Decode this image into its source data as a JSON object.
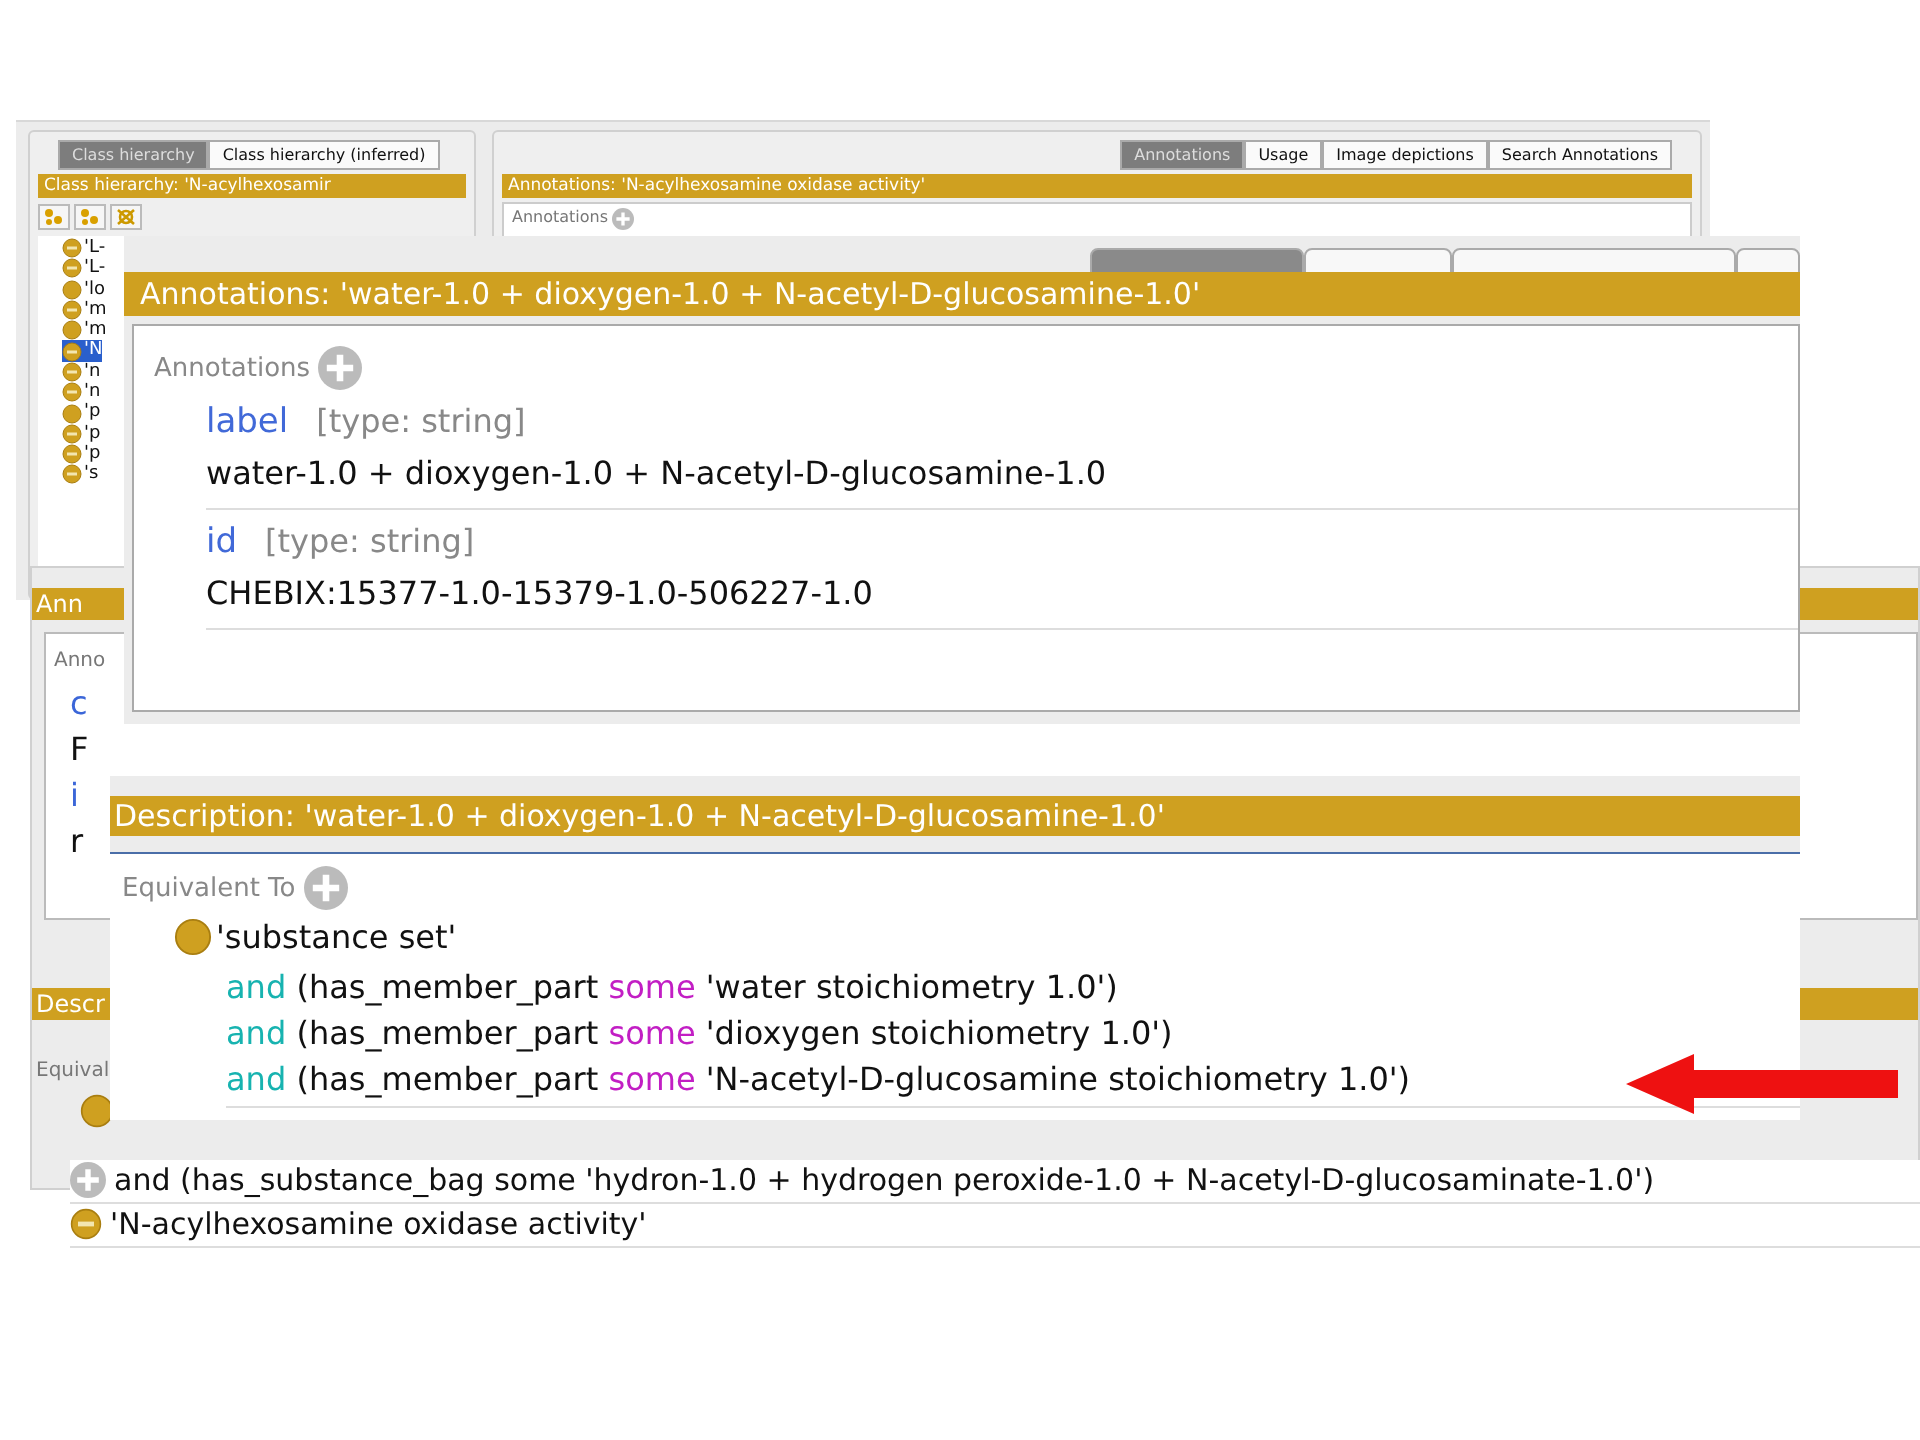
{
  "back_window": {
    "hierarchy_tabs": [
      {
        "label": "Class hierarchy",
        "selected": true
      },
      {
        "label": "Class hierarchy (inferred)",
        "selected": false
      }
    ],
    "hierarchy_title": "Class hierarchy: 'N-acylhexosamir",
    "tree_items": [
      {
        "label": "'L-",
        "kind": "defined",
        "selected": false
      },
      {
        "label": "'L-",
        "kind": "defined",
        "selected": false
      },
      {
        "label": "'lo",
        "kind": "primitive",
        "selected": false
      },
      {
        "label": "'m",
        "kind": "defined",
        "selected": false
      },
      {
        "label": "'m",
        "kind": "primitive",
        "selected": false
      },
      {
        "label": "'N",
        "kind": "defined",
        "selected": true
      },
      {
        "label": "'n",
        "kind": "defined",
        "selected": false
      },
      {
        "label": "'n",
        "kind": "defined",
        "selected": false
      },
      {
        "label": "'p",
        "kind": "primitive",
        "selected": false
      },
      {
        "label": "'p",
        "kind": "defined",
        "selected": false
      },
      {
        "label": "'p",
        "kind": "defined",
        "selected": false
      },
      {
        "label": "'s",
        "kind": "defined",
        "selected": false
      }
    ],
    "annotation_tabs": [
      {
        "label": "Annotations",
        "selected": true
      },
      {
        "label": "Usage",
        "selected": false
      },
      {
        "label": "Image depictions",
        "selected": false
      },
      {
        "label": "Search Annotations",
        "selected": false
      }
    ],
    "annotations_title": "Annotations: 'N-acylhexosamine oxidase activity'",
    "annotations_header": "Annotations"
  },
  "middle_window": {
    "title": "Ann",
    "header": "Anno",
    "rows": [
      {
        "text": "c",
        "kind": "property"
      },
      {
        "text": "F",
        "kind": "value"
      },
      {
        "text": "i",
        "kind": "property"
      },
      {
        "text": "r",
        "kind": "value"
      }
    ],
    "description_title": "Descr",
    "equivalent_header": "Equival"
  },
  "annotations_window": {
    "cut_tabs": [
      {
        "selected": true
      },
      {
        "selected": false
      },
      {
        "selected": false
      },
      {
        "selected": false
      }
    ],
    "title": "Annotations: 'water-1.0 + dioxygen-1.0 + N-acetyl-D-glucosamine-1.0'",
    "header": "Annotations",
    "entries": [
      {
        "property": "label",
        "type": "[type: string]",
        "value": "water-1.0 + dioxygen-1.0 + N-acetyl-D-glucosamine-1.0"
      },
      {
        "property": "id",
        "type": "[type: string]",
        "value": "CHEBIX:15377-1.0-15379-1.0-506227-1.0"
      }
    ]
  },
  "description_window": {
    "title": "Description: 'water-1.0 + dioxygen-1.0 + N-acetyl-D-glucosamine-1.0'",
    "header": "Equivalent To",
    "class_name": "'substance set'",
    "restrictions": [
      {
        "keyword": "and",
        "property": "(has_member_part",
        "quantifier": "some",
        "filler": "'water stoichiometry 1.0')"
      },
      {
        "keyword": "and",
        "property": "(has_member_part",
        "quantifier": "some",
        "filler": "'dioxygen stoichiometry 1.0')"
      },
      {
        "keyword": "and",
        "property": "(has_member_part",
        "quantifier": "some",
        "filler": "'N-acetyl-D-glucosamine stoichiometry 1.0')"
      }
    ]
  },
  "subclass_strip": {
    "axiom": "and (has_substance_bag some 'hydron-1.0 + hydrogen peroxide-1.0 + N-acetyl-D-glucosaminate-1.0')",
    "class_name": "'N-acylhexosamine oxidase activity'"
  }
}
